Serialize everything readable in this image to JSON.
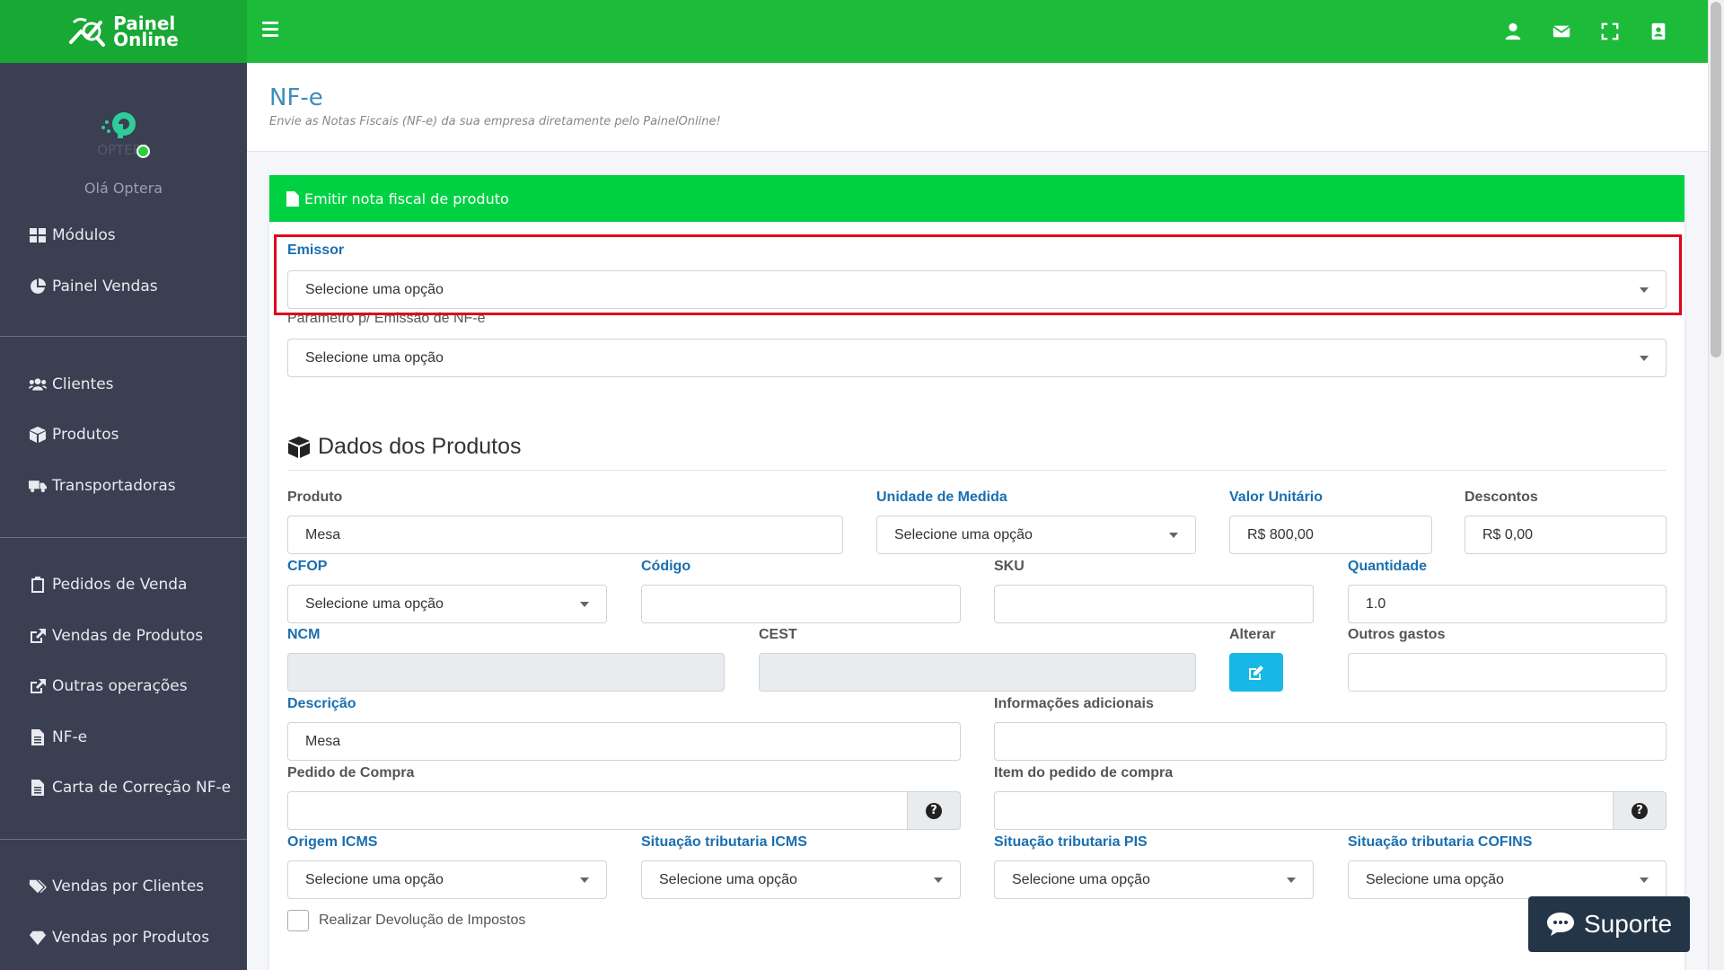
{
  "brand": {
    "line1": "Painel",
    "line2": "Online",
    "color": "#1dbb3a"
  },
  "sidebar": {
    "greeting": "Olá Optera",
    "avatar_text": "OPTERA",
    "groups": [
      [
        {
          "label": "Módulos",
          "icon": "grid-icon"
        },
        {
          "label": "Painel Vendas",
          "icon": "pie-chart-icon"
        }
      ],
      [
        {
          "label": "Clientes",
          "icon": "users-icon"
        },
        {
          "label": "Produtos",
          "icon": "box-icon"
        },
        {
          "label": "Transportadoras",
          "icon": "truck-icon"
        }
      ],
      [
        {
          "label": "Pedidos de Venda",
          "icon": "clipboard-icon"
        },
        {
          "label": "Vendas de Produtos",
          "icon": "share-icon"
        },
        {
          "label": "Outras operações",
          "icon": "share-icon"
        },
        {
          "label": "NF-e",
          "icon": "file-icon"
        },
        {
          "label": "Carta de Correção NF-e",
          "icon": "file-icon"
        }
      ],
      [
        {
          "label": "Vendas por Clientes",
          "icon": "tags-icon"
        },
        {
          "label": "Vendas por Produtos",
          "icon": "gem-icon"
        }
      ]
    ]
  },
  "page": {
    "title": "NF-e",
    "subtitle": "Envie as Notas Fiscais (NF-e) da sua empresa diretamente pelo PainelOnline!"
  },
  "card": {
    "header": "Emitir nota fiscal de produto",
    "emissor": {
      "label": "Emissor",
      "value": "Selecione uma opção"
    },
    "parametro": {
      "label": "Parametro p/ Emissão de NF-e",
      "value": "Selecione uma opção"
    }
  },
  "produtos": {
    "title": "Dados dos Produtos",
    "produto": {
      "label": "Produto",
      "value": "Mesa"
    },
    "unidade": {
      "label": "Unidade de Medida",
      "value": "Selecione uma opção"
    },
    "valor_unitario": {
      "label": "Valor Unitário",
      "value": "R$ 800,00"
    },
    "descontos": {
      "label": "Descontos",
      "value": "R$ 0,00"
    },
    "cfop": {
      "label": "CFOP",
      "value": "Selecione uma opção"
    },
    "codigo": {
      "label": "Código",
      "value": ""
    },
    "sku": {
      "label": "SKU",
      "value": ""
    },
    "quantidade": {
      "label": "Quantidade",
      "value": "1.0"
    },
    "ncm": {
      "label": "NCM",
      "value": ""
    },
    "cest": {
      "label": "CEST",
      "value": ""
    },
    "alterar": {
      "label": "Alterar"
    },
    "outros_gastos": {
      "label": "Outros gastos",
      "value": ""
    },
    "descricao": {
      "label": "Descrição",
      "value": "Mesa"
    },
    "info_adicionais": {
      "label": "Informações adicionais",
      "value": ""
    },
    "pedido_compra": {
      "label": "Pedido de Compra",
      "value": ""
    },
    "item_pedido": {
      "label": "Item do pedido de compra",
      "value": ""
    },
    "origem_icms": {
      "label": "Origem ICMS",
      "value": "Selecione uma opção"
    },
    "sit_icms": {
      "label": "Situação tributaria ICMS",
      "value": "Selecione uma opção"
    },
    "sit_pis": {
      "label": "Situação tributaria PIS",
      "value": "Selecione uma opção"
    },
    "sit_cofins": {
      "label": "Situação tributaria COFINS",
      "value": "Selecione uma opção"
    },
    "devolucao": {
      "label": "Realizar Devolução de Impostos",
      "checked": false
    }
  },
  "support": {
    "label": "Suporte"
  },
  "colors": {
    "card_header": "#00d142",
    "sidebar": "#3b3f52",
    "title_blue": "#3c8dbc",
    "highlight": "#e0001a",
    "edit_button": "#17b8e6"
  }
}
